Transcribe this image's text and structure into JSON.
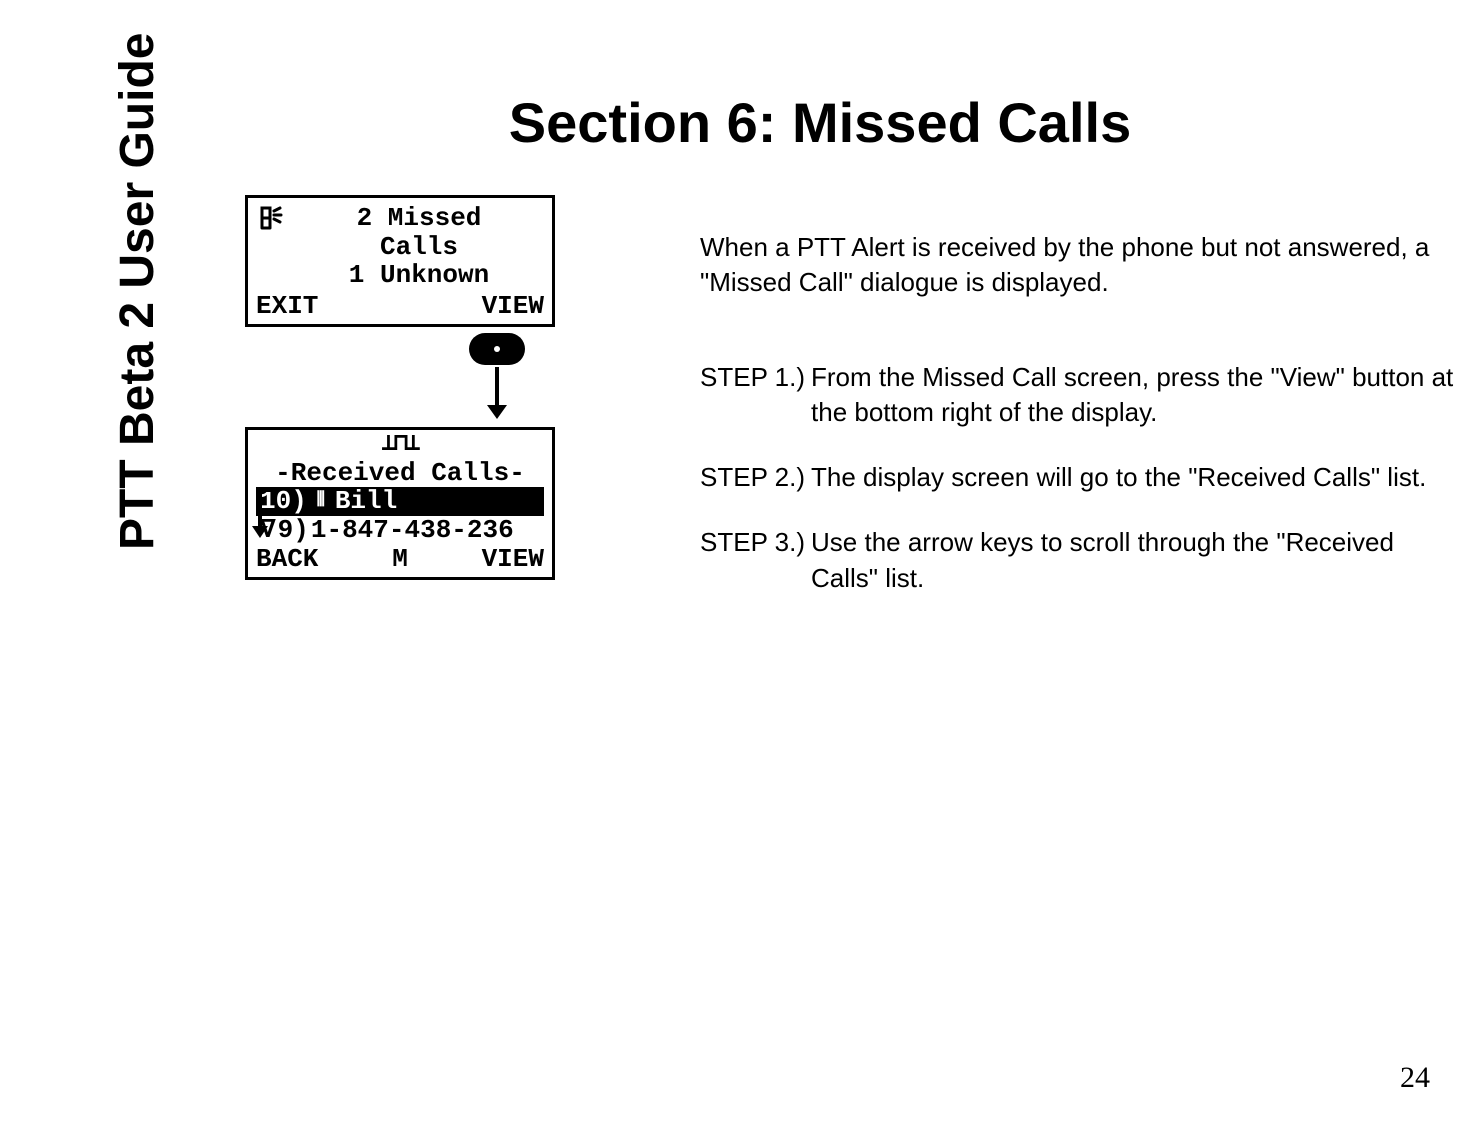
{
  "sidebar_title": "PTT Beta 2 User Guide",
  "section_title": "Section 6: Missed Calls",
  "screen1": {
    "line1": "2 Missed",
    "line2": "Calls",
    "line3": "1 Unknown",
    "soft_left": "EXIT",
    "soft_right": "VIEW"
  },
  "screen2": {
    "antenna": "⊥⊓⊥",
    "title": "-Received Calls-",
    "row1_num": "10)",
    "row1_name": "Bill",
    "row2_num": "9)",
    "row2_name": "1-847-438-236",
    "down_glyph": "∇",
    "soft_left": "BACK",
    "soft_mid": "M",
    "soft_right": "VIEW"
  },
  "intro": "When a PTT Alert is received by the phone but not answered, a \"Missed Call\" dialogue is displayed.",
  "steps": [
    {
      "label": "STEP 1.)",
      "body": "From the Missed Call screen, press the \"View\" button at the bottom right of the display."
    },
    {
      "label": "STEP 2.)",
      "body": "The display screen will go to the \"Received Calls\" list."
    },
    {
      "label": "STEP 3.)",
      "body": "Use the arrow keys to scroll through the \"Received Calls\" list."
    }
  ],
  "page_number": "24"
}
